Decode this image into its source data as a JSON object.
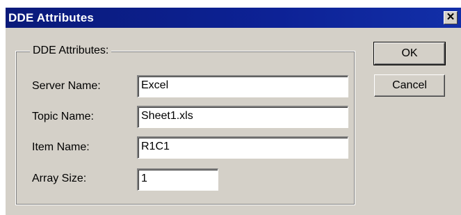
{
  "window": {
    "title": "DDE Attributes",
    "close_glyph": "✕"
  },
  "group": {
    "label": "DDE Attributes:"
  },
  "fields": {
    "server_name": {
      "label": "Server Name:",
      "value": "Excel"
    },
    "topic_name": {
      "label": "Topic Name:",
      "value": "Sheet1.xls"
    },
    "item_name": {
      "label": "Item Name:",
      "value": "R1C1"
    },
    "array_size": {
      "label": "Array Size:",
      "value": "1"
    }
  },
  "buttons": {
    "ok": "OK",
    "cancel": "Cancel"
  },
  "colors": {
    "titlebar": "#0a1a7a",
    "face": "#d4d0c8"
  },
  "icons": {
    "close": "close-icon"
  }
}
